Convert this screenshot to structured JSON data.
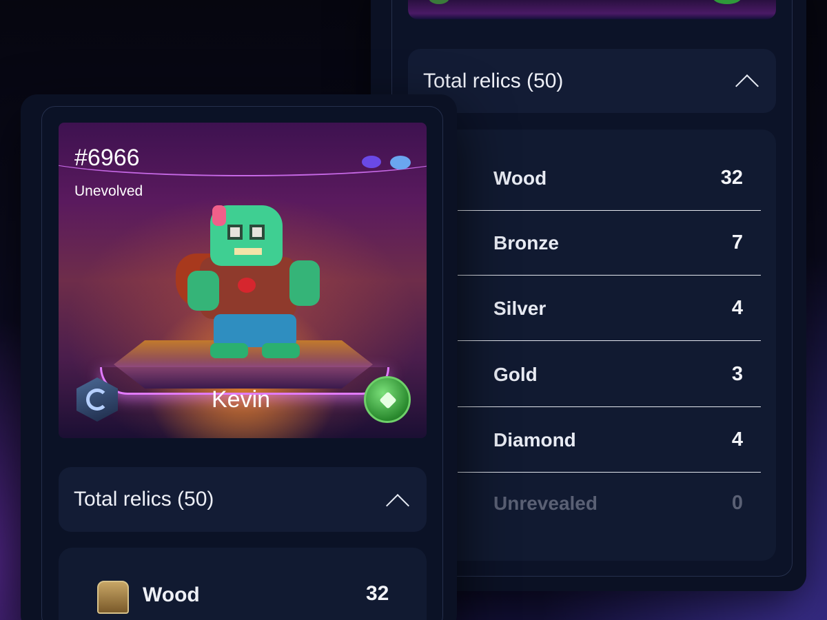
{
  "back_card": {
    "header": {
      "title": "Total relics (50)"
    },
    "relics": [
      {
        "label": "Wood",
        "count": "32",
        "chest_color": "#8a6a3a"
      },
      {
        "label": "Bronze",
        "count": "7",
        "chest_color": "#7a4a2c"
      },
      {
        "label": "Silver",
        "count": "4",
        "chest_color": "#4a5060"
      },
      {
        "label": "Gold",
        "count": "3",
        "chest_color": "#6b4a2a"
      },
      {
        "label": "Diamond",
        "count": "4",
        "chest_color": "#4c5270"
      },
      {
        "label": "Unrevealed",
        "count": "0",
        "chest_color": "#161d33"
      }
    ]
  },
  "front_card": {
    "nft": {
      "number": "#6966",
      "status": "Unevolved",
      "name": "Kevin"
    },
    "header": {
      "title": "Total relics (50)"
    },
    "relics": [
      {
        "label": "Wood",
        "count": "32"
      }
    ]
  },
  "colors": {
    "background": "#0a0a1c",
    "card": "#0b1124",
    "section": "#131c35",
    "accent_purple": "#e27bff",
    "accent_green": "#2f9a3a"
  }
}
